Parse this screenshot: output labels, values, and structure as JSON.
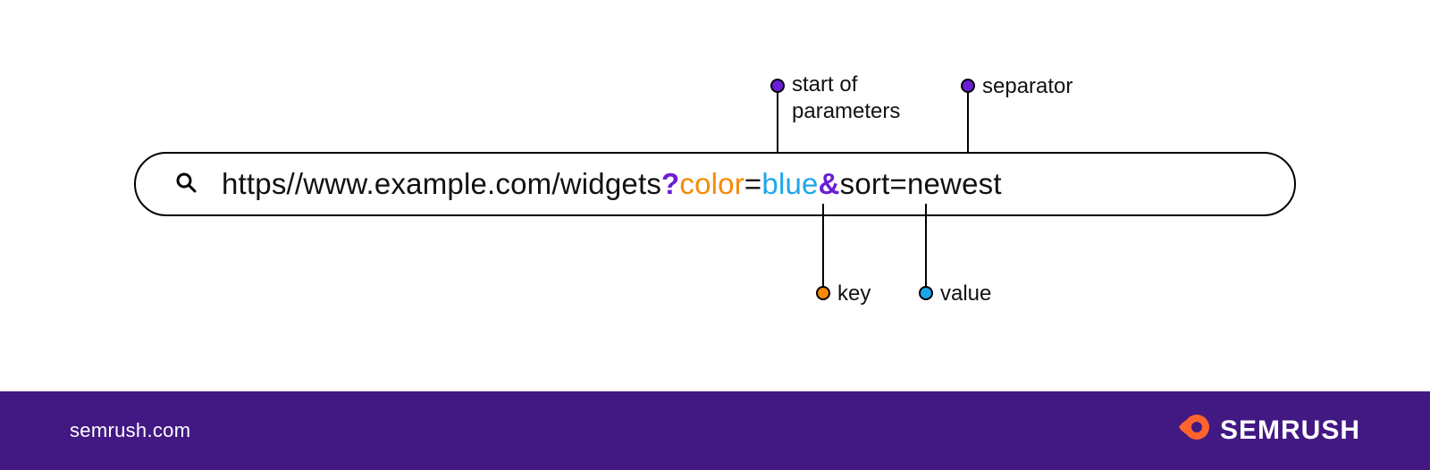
{
  "url": {
    "base": "https//www.example.com/widgets",
    "question_mark": "?",
    "key1": "color",
    "eq1": "=",
    "val1": "blue",
    "sep": "&",
    "rest": "sort=newest"
  },
  "annotations": {
    "start_params": "start of\nparameters",
    "separator": "separator",
    "key": "key",
    "value": "value"
  },
  "colors": {
    "purple": "#6A1ED6",
    "orange": "#F58A07",
    "blue": "#1CA7EC",
    "footer_bg": "#421983",
    "brand_orange": "#FF642D"
  },
  "footer": {
    "site": "semrush.com",
    "brand": "SEMRUSH"
  }
}
